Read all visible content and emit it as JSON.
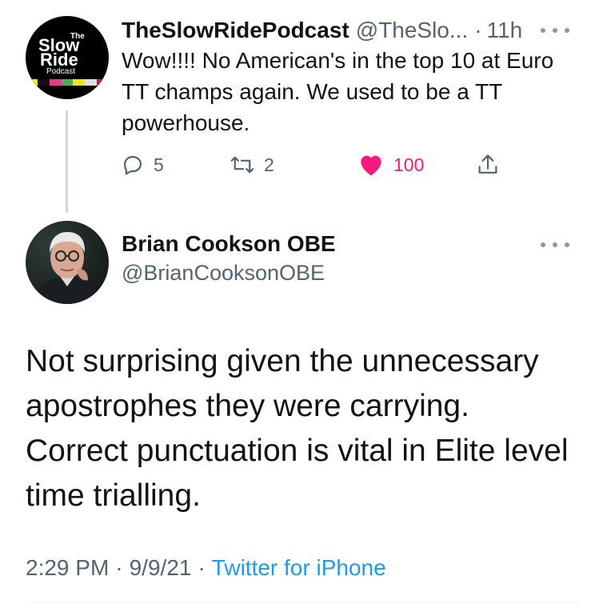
{
  "parent_tweet": {
    "avatar_text": [
      "The",
      "Slow",
      "Ride",
      "Podcast"
    ],
    "display_name": "TheSlowRidePodcast",
    "handle": "@TheSlo...",
    "separator": "·",
    "time": "11h",
    "text": "Wow!!!! No American's in the top 10 at Euro TT champs again. We used to be a TT powerhouse.",
    "actions": {
      "reply_icon": "reply-icon",
      "reply_count": "5",
      "retweet_icon": "retweet-icon",
      "retweet_count": "2",
      "like_icon": "heart-filled-icon",
      "like_count": "100",
      "share_icon": "share-icon"
    },
    "more_icon": "more-options-icon"
  },
  "main_tweet": {
    "display_name": "Brian Cookson OBE",
    "handle": "@BrianCooksonOBE",
    "more_icon": "more-options-icon",
    "text": "Not surprising given the unnecessary apostrophes they were carrying. Correct punctuation is vital in Elite level time trialling.",
    "time": "2:29 PM",
    "date": "9/9/21",
    "separator": "·",
    "source": "Twitter for iPhone"
  },
  "colors": {
    "text_primary": "#0f1419",
    "text_secondary": "#536471",
    "link": "#1d9bf0",
    "like_active": "#f91880",
    "divider": "#eff3f4",
    "thread_line": "#cfd9de"
  }
}
